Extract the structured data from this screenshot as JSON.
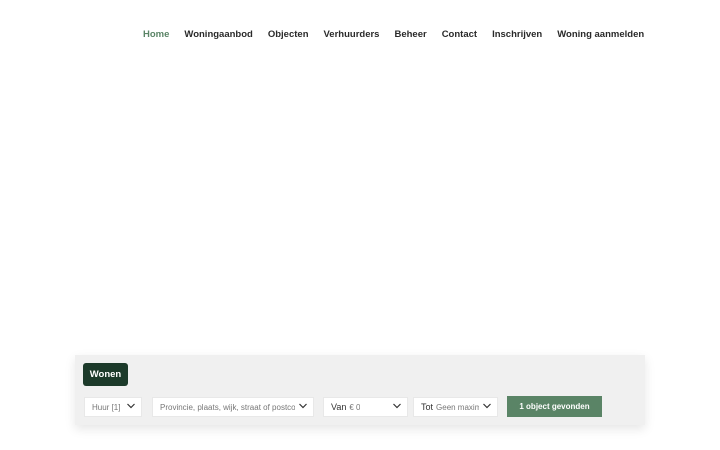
{
  "nav": {
    "items": [
      {
        "label": "Home",
        "active": true
      },
      {
        "label": "Woningaanbod"
      },
      {
        "label": "Objecten"
      },
      {
        "label": "Verhuurders"
      },
      {
        "label": "Beheer"
      },
      {
        "label": "Contact"
      },
      {
        "label": "Inschrijven"
      },
      {
        "label": "Woning aanmelden"
      }
    ]
  },
  "search": {
    "tab_label": "Wonen",
    "type_select": "Huur [1]",
    "location_placeholder": "Provincie, plaats, wijk, straat of postcode",
    "price_from_label": "Van",
    "price_from_value": "€ 0",
    "price_to_label": "Tot",
    "price_to_value": "Geen maximum",
    "result_button": "1 object gevonden"
  },
  "colors": {
    "accent": "#5a8466",
    "tab_bg": "#1c3a2a",
    "panel_bg": "#f0f0f0",
    "nav_text": "#2a2a2a"
  },
  "icons": {
    "dropdown": "chevron-down-icon"
  }
}
